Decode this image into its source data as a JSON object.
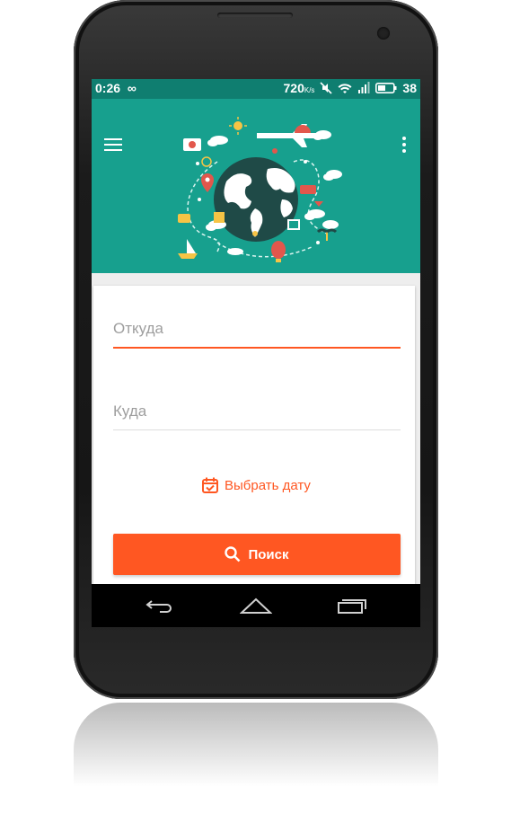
{
  "status_bar": {
    "time": "0:26",
    "infinity_icon": "∞",
    "network_speed": "720",
    "network_unit": "K/s",
    "battery_level": "38"
  },
  "header": {
    "bg_color": "#17a08e",
    "illustration": "travel-globe-illustration"
  },
  "form": {
    "from_placeholder": "Откуда",
    "to_placeholder": "Куда",
    "date_label": "Выбрать дату",
    "search_label": "Поиск"
  },
  "colors": {
    "accent": "#ff5722",
    "primary": "#17a08e",
    "primary_dark": "#0f7e70"
  }
}
